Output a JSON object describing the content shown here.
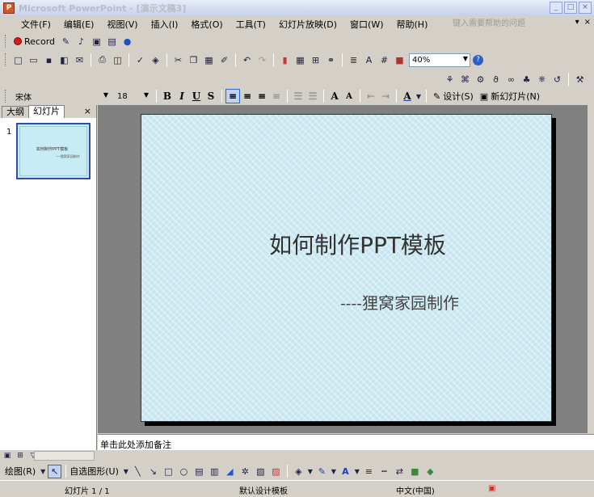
{
  "window": {
    "title": "Microsoft PowerPoint - [演示文稿3]",
    "logo": "P",
    "controls": [
      "_",
      "□",
      "×"
    ]
  },
  "menubar": {
    "items": [
      "文件(F)",
      "编辑(E)",
      "视图(V)",
      "插入(I)",
      "格式(O)",
      "工具(T)",
      "幻灯片放映(D)",
      "窗口(W)",
      "帮助(H)"
    ],
    "help_placeholder": "键入需要帮助的问题",
    "doc_controls": [
      "▾",
      "×"
    ]
  },
  "toolbar_record": {
    "record_label": "Record"
  },
  "toolbar_standard": {
    "zoom": "40%",
    "help_icon": "?"
  },
  "toolbar_formatting": {
    "font_name": "宋体",
    "font_size": "18",
    "bold": "B",
    "italic": "I",
    "underline": "U",
    "shadow": "S",
    "design_label": "设计(S)",
    "new_slide_label": "新幻灯片(N)"
  },
  "left_pane": {
    "tabs": [
      "大纲",
      "幻灯片"
    ],
    "close": "×",
    "slide_number": "1",
    "thumb_title": "如何制作PPT模板",
    "thumb_sub": "----狸窝家园制作"
  },
  "slide": {
    "title": "如何制作PPT模板",
    "subtitle": "----狸窝家园制作"
  },
  "notes": {
    "placeholder": "单击此处添加备注"
  },
  "drawing_toolbar": {
    "draw_label": "绘图(R)",
    "autoshape_label": "自选图形(U)"
  },
  "status_bar": {
    "slide_info": "幻灯片 1 / 1",
    "template": "默认设计模板",
    "language": "中文(中国)"
  },
  "colors": {
    "slide_bg": "#cdeaf2",
    "canvas_bg": "#808080",
    "chrome": "#d4d0c8"
  }
}
